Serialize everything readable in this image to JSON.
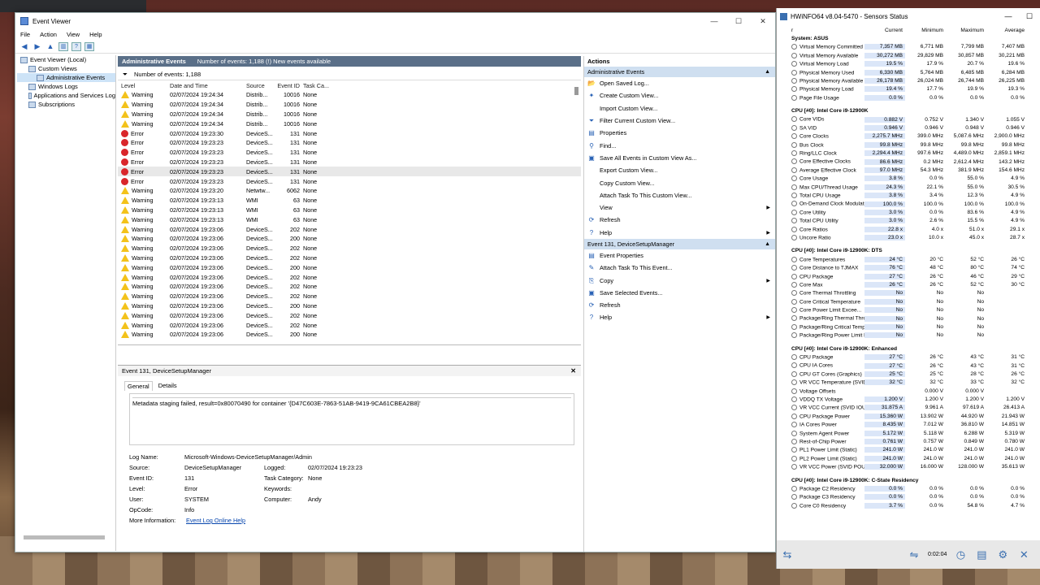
{
  "event_viewer": {
    "title": "Event Viewer",
    "window_buttons": [
      "—",
      "☐",
      "✕"
    ],
    "menu": [
      "File",
      "Action",
      "View",
      "Help"
    ],
    "tree": [
      {
        "label": "Event Viewer (Local)",
        "indent": 0
      },
      {
        "label": "Custom Views",
        "indent": 1
      },
      {
        "label": "Administrative Events",
        "indent": 2,
        "selected": true
      },
      {
        "label": "Windows Logs",
        "indent": 1
      },
      {
        "label": "Applications and Services Log",
        "indent": 1
      },
      {
        "label": "Subscriptions",
        "indent": 1
      }
    ],
    "header": {
      "title": "Administrative Events",
      "subtitle": "Number of events: 1,188 (!) New events available"
    },
    "filter_label": "Number of events: 1,188",
    "columns": [
      "Level",
      "Date and Time",
      "Source",
      "Event ID",
      "Task Ca..."
    ],
    "events": [
      [
        "Warning",
        "02/07/2024 19:24:34",
        "Distrib...",
        "10016",
        "None"
      ],
      [
        "Warning",
        "02/07/2024 19:24:34",
        "Distrib...",
        "10016",
        "None"
      ],
      [
        "Warning",
        "02/07/2024 19:24:34",
        "Distrib...",
        "10016",
        "None"
      ],
      [
        "Warning",
        "02/07/2024 19:24:34",
        "Distrib...",
        "10016",
        "None"
      ],
      [
        "Error",
        "02/07/2024 19:23:30",
        "DeviceS...",
        "131",
        "None"
      ],
      [
        "Error",
        "02/07/2024 19:23:23",
        "DeviceS...",
        "131",
        "None"
      ],
      [
        "Error",
        "02/07/2024 19:23:23",
        "DeviceS...",
        "131",
        "None"
      ],
      [
        "Error",
        "02/07/2024 19:23:23",
        "DeviceS...",
        "131",
        "None"
      ],
      [
        "Error",
        "02/07/2024 19:23:23",
        "DeviceS...",
        "131",
        "None"
      ],
      [
        "Error",
        "02/07/2024 19:23:23",
        "DeviceS...",
        "131",
        "None"
      ],
      [
        "Warning",
        "02/07/2024 19:23:20",
        "Netwtw...",
        "6062",
        "None"
      ],
      [
        "Warning",
        "02/07/2024 19:23:13",
        "WMI",
        "63",
        "None"
      ],
      [
        "Warning",
        "02/07/2024 19:23:13",
        "WMI",
        "63",
        "None"
      ],
      [
        "Warning",
        "02/07/2024 19:23:13",
        "WMI",
        "63",
        "None"
      ],
      [
        "Warning",
        "02/07/2024 19:23:06",
        "DeviceS...",
        "202",
        "None"
      ],
      [
        "Warning",
        "02/07/2024 19:23:06",
        "DeviceS...",
        "200",
        "None"
      ],
      [
        "Warning",
        "02/07/2024 19:23:06",
        "DeviceS...",
        "202",
        "None"
      ],
      [
        "Warning",
        "02/07/2024 19:23:06",
        "DeviceS...",
        "202",
        "None"
      ],
      [
        "Warning",
        "02/07/2024 19:23:06",
        "DeviceS...",
        "200",
        "None"
      ],
      [
        "Warning",
        "02/07/2024 19:23:06",
        "DeviceS...",
        "202",
        "None"
      ],
      [
        "Warning",
        "02/07/2024 19:23:06",
        "DeviceS...",
        "202",
        "None"
      ],
      [
        "Warning",
        "02/07/2024 19:23:06",
        "DeviceS...",
        "202",
        "None"
      ],
      [
        "Warning",
        "02/07/2024 19:23:06",
        "DeviceS...",
        "200",
        "None"
      ],
      [
        "Warning",
        "02/07/2024 19:23:06",
        "DeviceS...",
        "202",
        "None"
      ],
      [
        "Warning",
        "02/07/2024 19:23:06",
        "DeviceS...",
        "202",
        "None"
      ],
      [
        "Warning",
        "02/07/2024 19:23:06",
        "DeviceS...",
        "200",
        "None"
      ]
    ],
    "detail": {
      "header": "Event 131, DeviceSetupManager",
      "tabs": [
        "General",
        "Details"
      ],
      "message": "Metadata staging failed, result=0x80070490 for container '{D47C603E-7863-51AB-9419-9CA61CBEA2B8}'",
      "log_name_label": "Log Name:",
      "log_name": "Microsoft-Windows-DeviceSetupManager/Admin",
      "source_label": "Source:",
      "source": "DeviceSetupManager",
      "logged_label": "Logged:",
      "logged": "02/07/2024 19:23:23",
      "event_id_label": "Event ID:",
      "event_id": "131",
      "task_label": "Task Category:",
      "task": "None",
      "level_label": "Level:",
      "level": "Error",
      "keywords_label": "Keywords:",
      "keywords": "",
      "user_label": "User:",
      "user": "SYSTEM",
      "computer_label": "Computer:",
      "computer": "Andy",
      "opcode_label": "OpCode:",
      "opcode": "Info",
      "more_label": "More Information:",
      "more_link": "Event Log Online Help"
    },
    "actions": {
      "title": "Actions",
      "section1": "Administrative Events",
      "items1": [
        {
          "label": "Open Saved Log...",
          "icon": "open-log-icon",
          "glyph": "📂",
          "sub": false
        },
        {
          "label": "Create Custom View...",
          "icon": "create-view-icon",
          "glyph": "✦",
          "sub": false
        },
        {
          "label": "Import Custom View...",
          "icon": "import-view-icon",
          "glyph": "",
          "sub": false
        },
        {
          "label": "Filter Current Custom View...",
          "icon": "filter-icon",
          "glyph": "⏷",
          "sub": false
        },
        {
          "label": "Properties",
          "icon": "properties-icon",
          "glyph": "▤",
          "sub": false
        },
        {
          "label": "Find...",
          "icon": "find-icon",
          "glyph": "⚲",
          "sub": false
        },
        {
          "label": "Save All Events in Custom View As...",
          "icon": "save-icon",
          "glyph": "▣",
          "sub": false
        },
        {
          "label": "Export Custom View...",
          "icon": "export-icon",
          "glyph": "",
          "sub": false
        },
        {
          "label": "Copy Custom View...",
          "icon": "copy-icon",
          "glyph": "",
          "sub": false
        },
        {
          "label": "Attach Task To This Custom View...",
          "icon": "attach-task-icon",
          "glyph": "",
          "sub": false
        },
        {
          "label": "View",
          "icon": "view-icon",
          "glyph": "",
          "sub": true
        },
        {
          "label": "Refresh",
          "icon": "refresh-icon",
          "glyph": "⟳",
          "sub": false
        },
        {
          "label": "Help",
          "icon": "help-icon",
          "glyph": "?",
          "sub": true
        }
      ],
      "section2": "Event 131, DeviceSetupManager",
      "items2": [
        {
          "label": "Event Properties",
          "icon": "event-properties-icon",
          "glyph": "▤",
          "sub": false
        },
        {
          "label": "Attach Task To This Event...",
          "icon": "attach-task-icon",
          "glyph": "✎",
          "sub": false
        },
        {
          "label": "Copy",
          "icon": "copy-icon",
          "glyph": "⎘",
          "sub": true
        },
        {
          "label": "Save Selected Events...",
          "icon": "save-icon",
          "glyph": "▣",
          "sub": false
        },
        {
          "label": "Refresh",
          "icon": "refresh-icon",
          "glyph": "⟳",
          "sub": false
        },
        {
          "label": "Help",
          "icon": "help-icon",
          "glyph": "?",
          "sub": true
        }
      ]
    }
  },
  "hwinfo": {
    "title": "HWiNFO64 v8.04-5470 - Sensors Status",
    "window_buttons": [
      "—",
      "☐"
    ],
    "columns": [
      "r",
      "Current",
      "Minimum",
      "Maximum",
      "Average"
    ],
    "rows": [
      {
        "g": "System: ASUS"
      },
      [
        "Virtual Memory Committed",
        "7,357 MB",
        "6,771 MB",
        "7,799 MB",
        "7,407 MB"
      ],
      [
        "Virtual Memory Available",
        "30,272 MB",
        "29,829 MB",
        "30,857 MB",
        "30,221 MB"
      ],
      [
        "Virtual Memory Load",
        "19.5 %",
        "17.9 %",
        "20.7 %",
        "19.6 %"
      ],
      [
        "Physical Memory Used",
        "6,330 MB",
        "5,764 MB",
        "6,485 MB",
        "6,284 MB"
      ],
      [
        "Physical Memory Available",
        "26,178 MB",
        "26,024 MB",
        "26,744 MB",
        "26,225 MB"
      ],
      [
        "Physical Memory Load",
        "19.4 %",
        "17.7 %",
        "19.9 %",
        "19.3 %"
      ],
      [
        "Page File Usage",
        "0.0 %",
        "0.0 %",
        "0.0 %",
        "0.0 %"
      ],
      {
        "b": true
      },
      {
        "g": "CPU [#0]: Intel Core i9-12900K"
      },
      [
        "Core VIDs",
        "0.882 V",
        "0.752 V",
        "1.340 V",
        "1.055 V"
      ],
      [
        "SA VID",
        "0.946 V",
        "0.946 V",
        "0.948 V",
        "0.946 V"
      ],
      [
        "Core Clocks",
        "2,275.7 MHz",
        "399.0 MHz",
        "5,087.6 MHz",
        "2,900.0 MHz"
      ],
      [
        "Bus Clock",
        "99.8 MHz",
        "99.8 MHz",
        "99.8 MHz",
        "99.8 MHz"
      ],
      [
        "Ring/LLC Clock",
        "2,294.4 MHz",
        "997.6 MHz",
        "4,489.0 MHz",
        "2,859.1 MHz"
      ],
      [
        "Core Effective Clocks",
        "86.6 MHz",
        "0.2 MHz",
        "2,612.4 MHz",
        "143.2 MHz"
      ],
      [
        "Average Effective Clock",
        "97.0 MHz",
        "54.3 MHz",
        "381.9 MHz",
        "154.6 MHz"
      ],
      [
        "Core Usage",
        "3.8 %",
        "0.0 %",
        "55.0 %",
        "4.9 %"
      ],
      [
        "Max CPU/Thread Usage",
        "24.3 %",
        "22.1 %",
        "55.0 %",
        "30.5 %"
      ],
      [
        "Total CPU Usage",
        "3.8 %",
        "3.4 %",
        "12.3 %",
        "4.9 %"
      ],
      [
        "On-Demand Clock Modulation",
        "100.0 %",
        "100.0 %",
        "100.0 %",
        "100.0 %"
      ],
      [
        "Core Utility",
        "3.0 %",
        "0.0 %",
        "83.6 %",
        "4.9 %"
      ],
      [
        "Total CPU Utility",
        "3.0 %",
        "2.6 %",
        "15.5 %",
        "4.9 %"
      ],
      [
        "Core Ratios",
        "22.8 x",
        "4.0 x",
        "51.0 x",
        "29.1 x"
      ],
      [
        "Uncore Ratio",
        "23.0 x",
        "10.0 x",
        "45.0 x",
        "28.7 x"
      ],
      {
        "b": true
      },
      {
        "g": "CPU [#0]: Intel Core i9-12900K: DTS"
      },
      [
        "Core Temperatures",
        "24 °C",
        "20 °C",
        "52 °C",
        "26 °C"
      ],
      [
        "Core Distance to TJMAX",
        "76 °C",
        "48 °C",
        "80 °C",
        "74 °C"
      ],
      [
        "CPU Package",
        "27 °C",
        "26 °C",
        "46 °C",
        "29 °C"
      ],
      [
        "Core Max",
        "26 °C",
        "26 °C",
        "52 °C",
        "30 °C"
      ],
      [
        "Core Thermal Throttling",
        "No",
        "No",
        "No",
        ""
      ],
      [
        "Core Critical Temperature",
        "No",
        "No",
        "No",
        ""
      ],
      [
        "Core Power Limit Excee...",
        "No",
        "No",
        "No",
        ""
      ],
      [
        "Package/Ring Thermal Thro...",
        "No",
        "No",
        "No",
        ""
      ],
      [
        "Package/Ring Critical Temp...",
        "No",
        "No",
        "No",
        ""
      ],
      [
        "Package/Ring Power Limit E...",
        "No",
        "No",
        "No",
        ""
      ],
      {
        "b": true
      },
      {
        "g": "CPU [#0]: Intel Core i9-12900K: Enhanced"
      },
      [
        "CPU Package",
        "27 °C",
        "26 °C",
        "43 °C",
        "31 °C"
      ],
      [
        "CPU IA Cores",
        "27 °C",
        "26 °C",
        "43 °C",
        "31 °C"
      ],
      [
        "CPU GT Cores (Graphics)",
        "25 °C",
        "25 °C",
        "28 °C",
        "26 °C"
      ],
      [
        "VR VCC Temperature (SVID)",
        "32 °C",
        "32 °C",
        "33 °C",
        "32 °C"
      ],
      [
        "Voltage Offsets",
        "",
        "0.000 V",
        "0.000 V",
        ""
      ],
      [
        "VDDQ TX Voltage",
        "1.200 V",
        "1.200 V",
        "1.200 V",
        "1.200 V"
      ],
      [
        "VR VCC Current (SVID IOUT)",
        "31.875 A",
        "9.961 A",
        "97.619 A",
        "26.413 A"
      ],
      [
        "CPU Package Power",
        "15.360 W",
        "13.902 W",
        "44.920 W",
        "21.943 W"
      ],
      [
        "IA Cores Power",
        "8.435 W",
        "7.012 W",
        "36.810 W",
        "14.851 W"
      ],
      [
        "System Agent Power",
        "5.172 W",
        "5.118 W",
        "6.288 W",
        "5.319 W"
      ],
      [
        "Rest-of-Chip Power",
        "0.761 W",
        "0.757 W",
        "0.849 W",
        "0.780 W"
      ],
      [
        "PL1 Power Limit (Static)",
        "241.0 W",
        "241.0 W",
        "241.0 W",
        "241.0 W"
      ],
      [
        "PL2 Power Limit (Static)",
        "241.0 W",
        "241.0 W",
        "241.0 W",
        "241.0 W"
      ],
      [
        "VR VCC Power (SVID POUT)",
        "32.000 W",
        "16.000 W",
        "128.000 W",
        "35.613 W"
      ],
      {
        "b": true
      },
      {
        "g": "CPU [#0]: Intel Core i9-12900K: C-State Residency"
      },
      [
        "Package C2 Residency",
        "0.0 %",
        "0.0 %",
        "0.0 %",
        "0.0 %"
      ],
      [
        "Package C3 Residency",
        "0.0 %",
        "0.0 %",
        "0.0 %",
        "0.0 %"
      ],
      [
        "Core C0 Residency",
        "3.7 %",
        "0.0 %",
        "54.8 %",
        "4.7 %"
      ]
    ],
    "timer": "0:02:04"
  }
}
